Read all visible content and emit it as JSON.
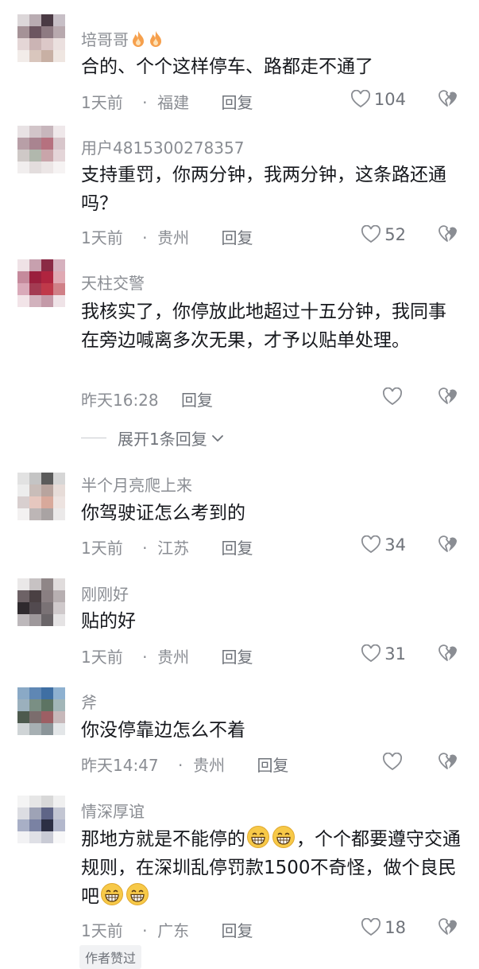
{
  "comments": [
    {
      "name": "培哥哥",
      "text": "合的、个个这样停车、路都走不通了",
      "time": "1天前",
      "sep": "·",
      "location": "福建",
      "reply": "回复",
      "likes": "104",
      "avatar": [
        "#dcd7d9",
        "#b9acb2",
        "#4a3a44",
        "#c7bfc6",
        "#a59297",
        "#6c5560",
        "#8e7a82",
        "#b8a9ae",
        "#e4d6d6",
        "#cbb4b4",
        "#dcc8c8",
        "#ebe0df",
        "#f2ece9",
        "#d9c6bd",
        "#c8b0a4",
        "#efe6e1"
      ]
    },
    {
      "name": "用户4815300278357",
      "text": "支持重罚，你两分钟，我两分钟，这条路还通吗？",
      "time": "1天前",
      "sep": "·",
      "location": "贵州",
      "reply": "回复",
      "likes": "52",
      "avatar": [
        "#e8e2e4",
        "#d2c5c9",
        "#c7b6bc",
        "#efe8ea",
        "#b89fa7",
        "#a98490",
        "#b6717f",
        "#d8c6cb",
        "#cfc9c7",
        "#b1b8ad",
        "#c9a5aa",
        "#e4d5d8",
        "#f1eeee",
        "#e3dddd",
        "#ece6e6",
        "#f6f3f3"
      ]
    },
    {
      "name": "天柱交警",
      "text": "我核实了，你停放此地超过十五分钟，我同事在旁边喊离多次无果，才予以贴单处理。",
      "time": "昨天16:28",
      "sep": "",
      "location": "",
      "reply": "回复",
      "likes": "",
      "avatar": [
        "#efe2e6",
        "#c7a0ae",
        "#8a2a45",
        "#d6b1be",
        "#c58a9c",
        "#9a1f3d",
        "#b0243f",
        "#e0a9b3",
        "#d9aab9",
        "#a33b52",
        "#c0394a",
        "#d08087",
        "#f2e4e8",
        "#d2b2bd",
        "#c49aa8",
        "#efe3e7"
      ]
    },
    {
      "name": "半个月亮爬上来",
      "text": "你驾驶证怎么考到的",
      "time": "1天前",
      "sep": "·",
      "location": "江苏",
      "reply": "回复",
      "likes": "34",
      "avatar": [
        "#e2e2e2",
        "#c4c4c4",
        "#5b5b5b",
        "#d6d6d6",
        "#ededed",
        "#c9bdb9",
        "#b8a49e",
        "#e7dcd8",
        "#d8cfcf",
        "#e6c7bf",
        "#d8a99b",
        "#ede3e0",
        "#f3f1f1",
        "#bdb6b6",
        "#a9a3a3",
        "#ebe9e9"
      ]
    },
    {
      "name": "刚刚好",
      "text": "贴的好",
      "time": "1天前",
      "sep": "·",
      "location": "贵州",
      "reply": "回复",
      "likes": "31",
      "avatar": [
        "#eae8e8",
        "#c7c2c3",
        "#8f8687",
        "#e0dcdc",
        "#6d6266",
        "#4a4043",
        "#8a7f82",
        "#b7afb1",
        "#2f2a2e",
        "#524a4f",
        "#7a7275",
        "#cfc9cb",
        "#bdb8bb",
        "#9e989b",
        "#6a6568",
        "#e5e3e4"
      ]
    },
    {
      "name": "斧",
      "text": "你没停靠边怎么不着",
      "time": "昨天14:47",
      "sep": "·",
      "location": "贵州",
      "reply": "回复",
      "likes": "",
      "avatar": [
        "#8aa9c6",
        "#5f87b4",
        "#3f6fa3",
        "#8eb1d0",
        "#9bb0bd",
        "#7a8f84",
        "#5d7463",
        "#a2b6b8",
        "#4d5a4e",
        "#7b6d6d",
        "#9d5f64",
        "#c7b8ba",
        "#cfd4d6",
        "#a7b0b3",
        "#8b9599",
        "#e3e6e8"
      ]
    },
    {
      "name": "情深厚谊",
      "text": "",
      "time": "1天前",
      "sep": "·",
      "location": "广东",
      "reply": "回复",
      "likes": "18",
      "avatar": [
        "#f4f4f4",
        "#e6e6e6",
        "#d8d8d8",
        "#f0f0f0",
        "#dcdde2",
        "#9ea3b6",
        "#5f6587",
        "#c3c6d3",
        "#a8afc6",
        "#7a82a3",
        "#2c2f44",
        "#b3b8cc",
        "#f2f2f4",
        "#dfe0e6",
        "#c9cbd5",
        "#f7f7f8"
      ]
    }
  ],
  "last_comment_parts": {
    "a": "那地方就是不能停的",
    "b": "，个个都要遵守交通规则，在深圳乱停罚款1500不奇怪，做个良民吧"
  },
  "expand_label": "展开1条回复",
  "author_badge": "作者赞过",
  "icons": {
    "flame": "flame-icon",
    "like": "heart-outline-icon",
    "dislike": "broken-heart-icon",
    "chevron": "chevron-down-icon",
    "grin": "grinning-emoji"
  }
}
